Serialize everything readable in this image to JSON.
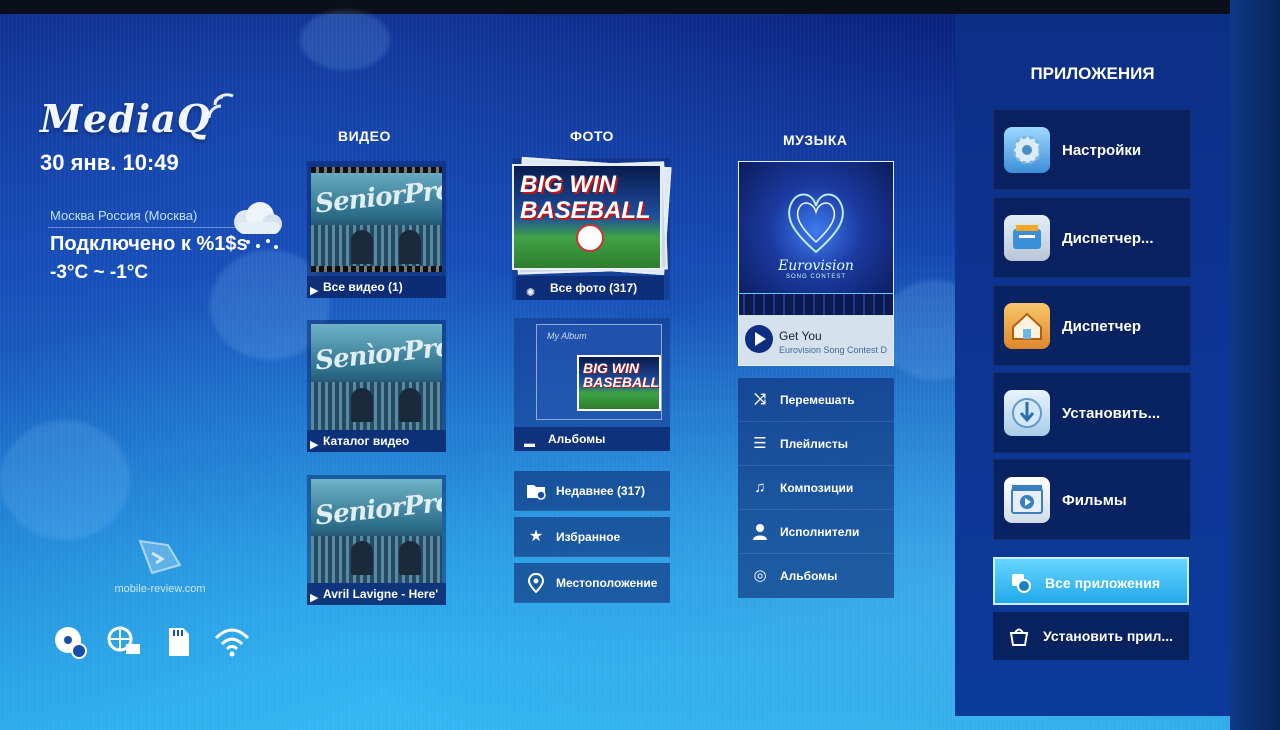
{
  "brand": {
    "logo_text": "MediaQ"
  },
  "clock": {
    "datetime": "30 янв. 10:49"
  },
  "weather": {
    "location": "Москва Россия (Москва)",
    "status": "Подключено к %1$s",
    "temperature": "-3°C ~ -1°C"
  },
  "watermark": "mobile-review.com",
  "status_icons": [
    "usb-bluetooth-icon",
    "network-icon",
    "sd-card-icon",
    "wifi-icon"
  ],
  "video": {
    "title": "ВИДЕО",
    "tiles": [
      {
        "label": "Все видео (1)"
      },
      {
        "label": "Каталог видео"
      },
      {
        "label": "Avril Lavigne - Here'"
      }
    ]
  },
  "photo": {
    "title": "ФОТО",
    "all_label": "Все фото (317)",
    "albums_label": "Альбомы",
    "thumb_text_line1": "BIG WIN",
    "thumb_text_line2": "BASEBALL",
    "album_caption": "My Album",
    "list": [
      {
        "icon": "folder-clock-icon",
        "label": "Недавнее (317)"
      },
      {
        "icon": "star-icon",
        "label": "Избранное"
      },
      {
        "icon": "location-pin-icon",
        "label": "Местоположение"
      }
    ]
  },
  "music": {
    "title": "МУЗЫКА",
    "album_title": "Eurovision",
    "album_subtitle": "SONG CONTEST",
    "now_playing": {
      "track": "Get You",
      "artist": "Eurovision Song Contest D"
    },
    "list": [
      {
        "icon": "shuffle-icon",
        "label": "Перемешать"
      },
      {
        "icon": "playlist-icon",
        "label": "Плейлисты"
      },
      {
        "icon": "music-note-icon",
        "label": "Композиции"
      },
      {
        "icon": "person-icon",
        "label": "Исполнители"
      },
      {
        "icon": "disc-icon",
        "label": "Альбомы"
      }
    ]
  },
  "apps": {
    "title": "ПРИЛОЖЕНИЯ",
    "tiles": [
      {
        "label": "Настройки",
        "icon": "settings-gear-icon"
      },
      {
        "label": "Диспетчер...",
        "icon": "file-manager-icon"
      },
      {
        "label": "Диспетчер",
        "icon": "home-manager-icon"
      },
      {
        "label": "Установить...",
        "icon": "installer-icon"
      },
      {
        "label": "Фильмы",
        "icon": "movies-icon"
      }
    ],
    "all_apps_label": "Все приложения",
    "install_label": "Установить прил..."
  }
}
